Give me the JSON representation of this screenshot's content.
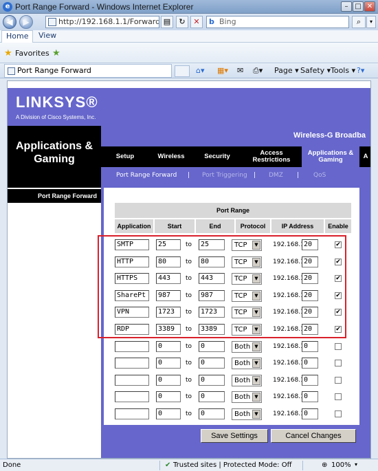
{
  "window": {
    "title": "Port Range Forward - Windows Internet Explorer",
    "min": "–",
    "max": "□",
    "close": "✕"
  },
  "address": {
    "url": "http://192.168.1.1/Forward.asp",
    "search_placeholder": "Bing"
  },
  "menu": {
    "tabs": [
      "Home",
      "View"
    ]
  },
  "favorites": {
    "label": "Favorites"
  },
  "tab": {
    "title": "Port Range Forward"
  },
  "commands": {
    "page": "Page",
    "safety": "Safety",
    "tools": "Tools"
  },
  "linksys": {
    "logo": "LINKSYS®",
    "tagline": "A Division of Cisco Systems, Inc.",
    "section": "Applications & Gaming",
    "model": "Wireless-G Broadba",
    "tabs": [
      "Setup",
      "Wireless",
      "Security",
      "Access Restrictions",
      "Applications & Gaming",
      "A"
    ],
    "subtabs": [
      "Port Range Forward",
      "Port Triggering",
      "DMZ",
      "QoS"
    ],
    "sidebar_title": "Port Range Forward"
  },
  "table": {
    "title": "Port Range",
    "headers": [
      "Application",
      "Start",
      "End",
      "Protocol",
      "IP Address",
      "Enable"
    ],
    "to_label": "to",
    "ip_prefix": "192.168.1.",
    "rows": [
      {
        "app": "SMTP",
        "start": "25",
        "end": "25",
        "protocol": "TCP",
        "ip": "20",
        "enabled": true
      },
      {
        "app": "HTTP",
        "start": "80",
        "end": "80",
        "protocol": "TCP",
        "ip": "20",
        "enabled": true
      },
      {
        "app": "HTTPS",
        "start": "443",
        "end": "443",
        "protocol": "TCP",
        "ip": "20",
        "enabled": true
      },
      {
        "app": "SharePt",
        "start": "987",
        "end": "987",
        "protocol": "TCP",
        "ip": "20",
        "enabled": true
      },
      {
        "app": "VPN",
        "start": "1723",
        "end": "1723",
        "protocol": "TCP",
        "ip": "20",
        "enabled": true
      },
      {
        "app": "RDP",
        "start": "3389",
        "end": "3389",
        "protocol": "TCP",
        "ip": "20",
        "enabled": true
      },
      {
        "app": "",
        "start": "0",
        "end": "0",
        "protocol": "Both",
        "ip": "0",
        "enabled": false
      },
      {
        "app": "",
        "start": "0",
        "end": "0",
        "protocol": "Both",
        "ip": "0",
        "enabled": false
      },
      {
        "app": "",
        "start": "0",
        "end": "0",
        "protocol": "Both",
        "ip": "0",
        "enabled": false
      },
      {
        "app": "",
        "start": "0",
        "end": "0",
        "protocol": "Both",
        "ip": "0",
        "enabled": false
      },
      {
        "app": "",
        "start": "0",
        "end": "0",
        "protocol": "Both",
        "ip": "0",
        "enabled": false
      }
    ]
  },
  "buttons": {
    "save": "Save Settings",
    "cancel": "Cancel Changes"
  },
  "status": {
    "left": "Done",
    "zone": "Trusted sites | Protected Mode: Off",
    "zoom": "100%"
  }
}
